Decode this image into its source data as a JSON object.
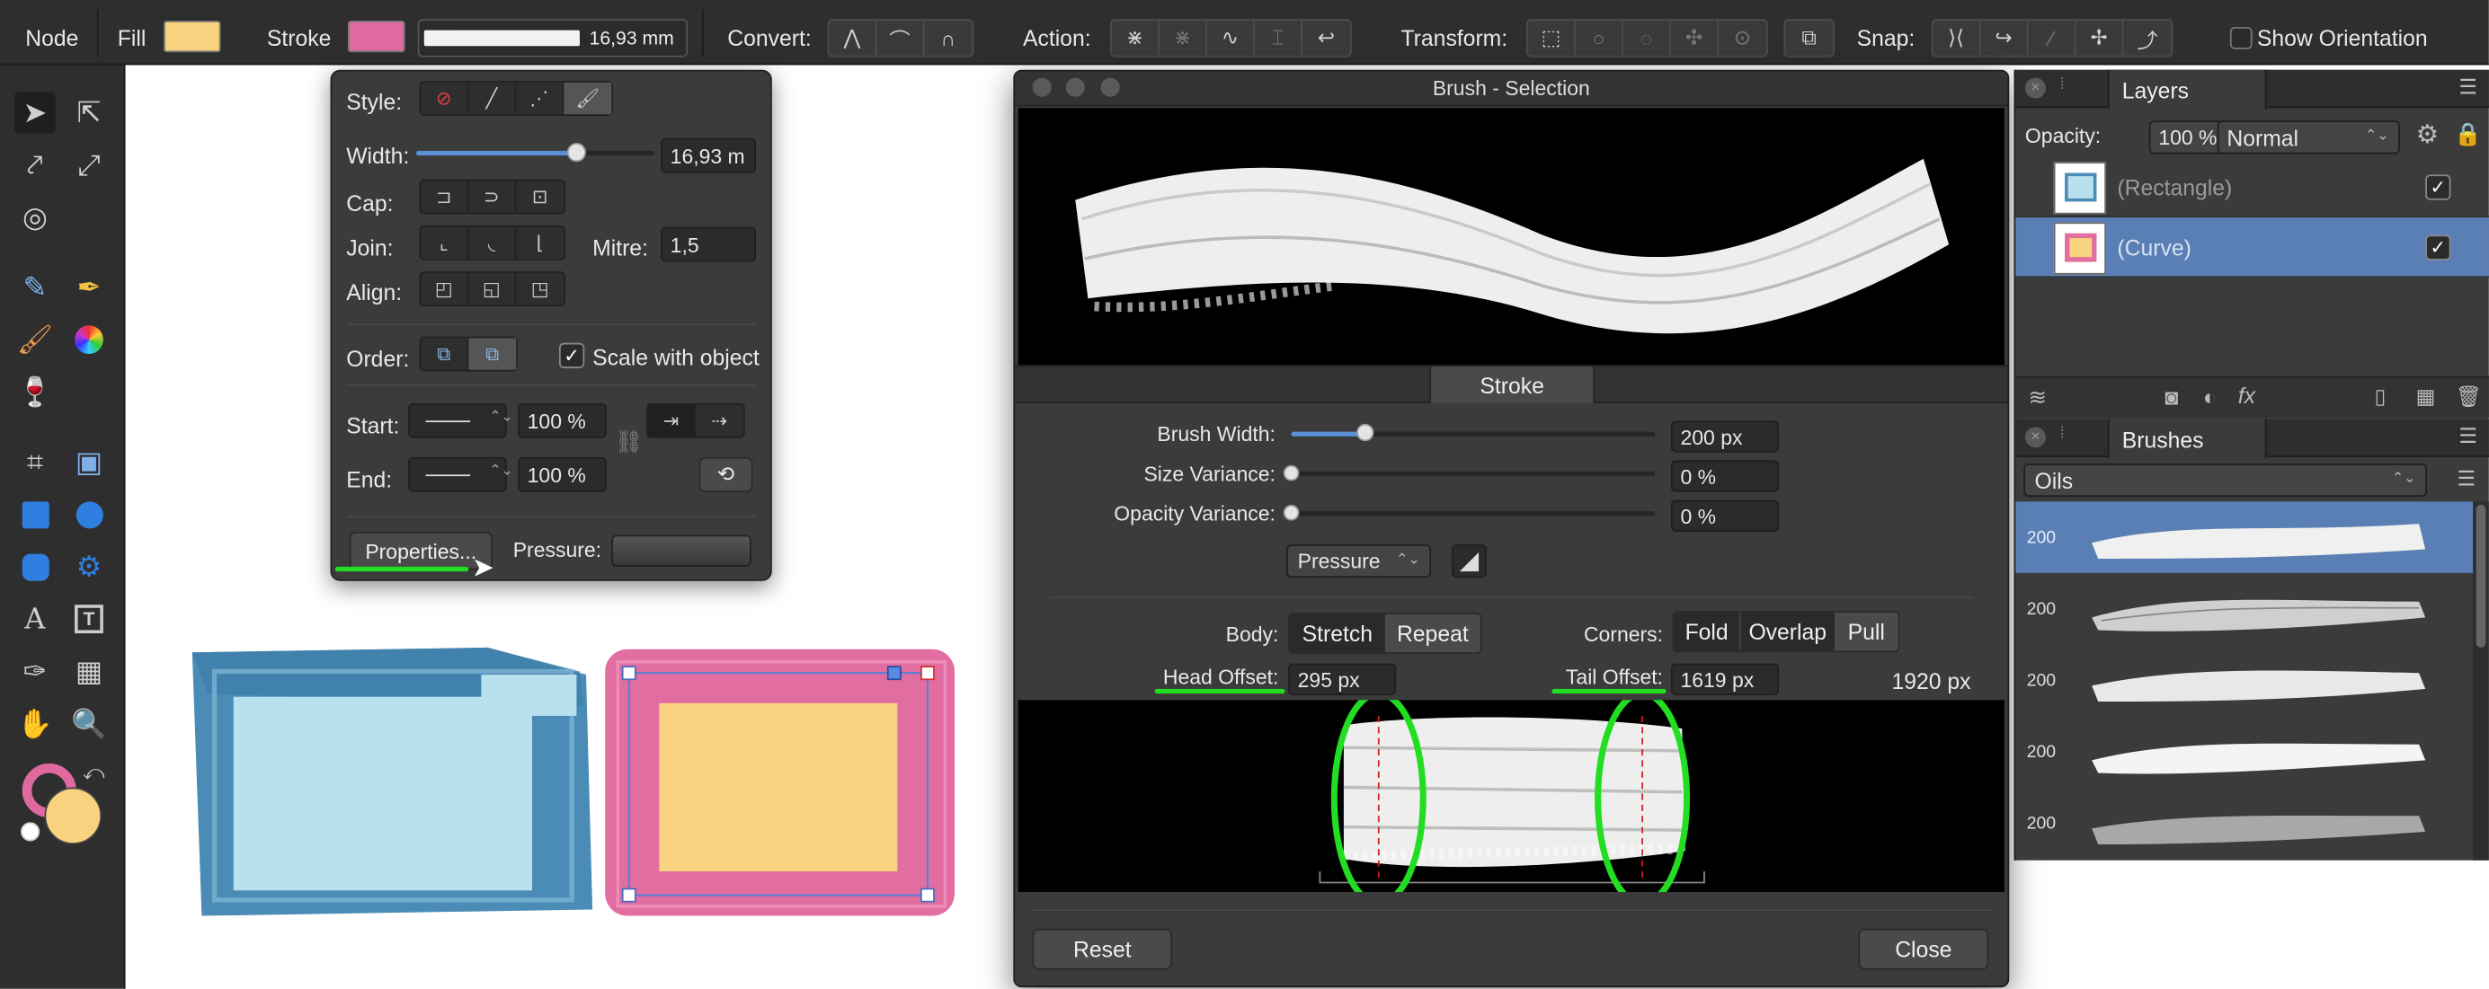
{
  "context_toolbar": {
    "mode": "Node",
    "fill_label": "Fill",
    "stroke_label": "Stroke",
    "stroke_width": "16,93 mm",
    "convert_label": "Convert:",
    "action_label": "Action:",
    "transform_label": "Transform:",
    "snap_label": "Snap:",
    "show_orientation": "Show Orientation"
  },
  "colors": {
    "fill": "#f8d27e",
    "stroke": "#e06aa0",
    "accent": "#5a7fb5",
    "blue_rect": "#4a8cb5",
    "light_blue": "#b9e0ef",
    "pink": "#e26da1",
    "yellow": "#f8d27e",
    "annotation_green": "#22dd22"
  },
  "stroke_panel": {
    "style_label": "Style:",
    "width_label": "Width:",
    "width_value": "16,93 m",
    "width_fraction": 0.67,
    "cap_label": "Cap:",
    "join_label": "Join:",
    "mitre_label": "Mitre:",
    "mitre_value": "1,5",
    "align_label": "Align:",
    "order_label": "Order:",
    "scale_with_object": "Scale with object",
    "start_label": "Start:",
    "end_label": "End:",
    "start_pct": "100 %",
    "end_pct": "100 %",
    "properties_button": "Properties...",
    "pressure_label": "Pressure:"
  },
  "brush_dialog": {
    "title": "Brush - Selection",
    "tab": "Stroke",
    "brush_width_label": "Brush Width:",
    "brush_width_value": "200 px",
    "brush_width_fraction": 0.2,
    "size_variance_label": "Size Variance:",
    "size_variance_value": "0 %",
    "opacity_variance_label": "Opacity Variance:",
    "opacity_variance_value": "0 %",
    "pressure_select": "Pressure",
    "body_label": "Body:",
    "body_options": [
      "Stretch",
      "Repeat"
    ],
    "corners_label": "Corners:",
    "corners_options": [
      "Fold",
      "Overlap",
      "Pull"
    ],
    "head_offset_label": "Head Offset:",
    "head_offset_value": "295 px",
    "tail_offset_label": "Tail Offset:",
    "tail_offset_value": "1619 px",
    "total_length": "1920 px",
    "reset_button": "Reset",
    "close_button": "Close"
  },
  "layers_panel": {
    "title": "Layers",
    "opacity_label": "Opacity:",
    "opacity_value": "100 %",
    "blend_mode": "Normal",
    "layers": [
      {
        "name": "(Rectangle)",
        "visible": true,
        "selected": false
      },
      {
        "name": "(Curve)",
        "visible": true,
        "selected": true
      }
    ]
  },
  "brushes_panel": {
    "title": "Brushes",
    "category": "Oils",
    "brush_sizes": [
      "200",
      "200",
      "200",
      "200",
      "200"
    ]
  }
}
